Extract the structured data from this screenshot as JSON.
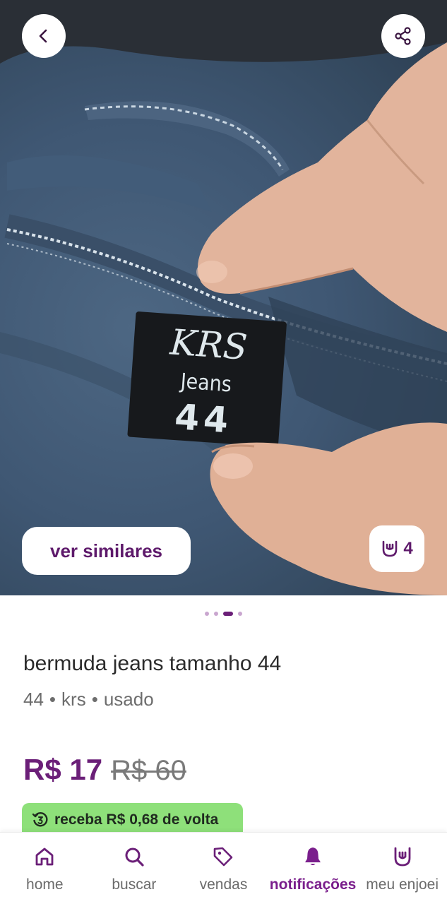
{
  "photo": {
    "label_brand": "KRS",
    "label_line": "Jeans",
    "label_size": "44",
    "similar_label": "ver similares",
    "likes_count": "4"
  },
  "product": {
    "title": "bermuda jeans tamanho 44",
    "meta": [
      "44",
      "krs",
      "usado"
    ],
    "price": "R$ 17",
    "old_price": "R$ 60",
    "cashback": "receba R$ 0,68 de volta"
  },
  "carousel": {
    "total": 4,
    "active": 3
  },
  "tabs": [
    {
      "label": "home",
      "icon": "home-icon"
    },
    {
      "label": "buscar",
      "icon": "search-icon"
    },
    {
      "label": "vendas",
      "icon": "price-tag-icon"
    },
    {
      "label": "notificações",
      "icon": "bell-icon"
    },
    {
      "label": "meu enjoei",
      "icon": "rock-hand-icon"
    }
  ],
  "colors": {
    "brand": "#6b1f78",
    "cashback_bg": "#8ee07a",
    "accent_text": "#5e1a6b"
  }
}
